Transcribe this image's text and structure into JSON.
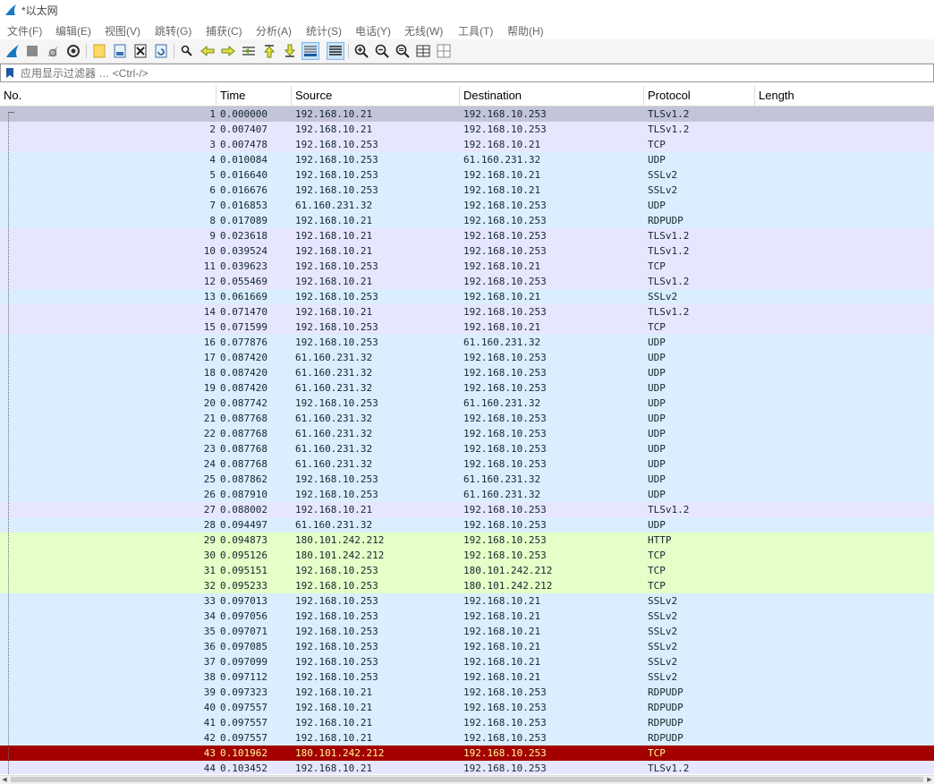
{
  "window": {
    "title": "*以太网"
  },
  "menu": [
    {
      "label": "文件(F)"
    },
    {
      "label": "编辑(E)"
    },
    {
      "label": "视图(V)"
    },
    {
      "label": "跳转(G)"
    },
    {
      "label": "捕获(C)"
    },
    {
      "label": "分析(A)"
    },
    {
      "label": "统计(S)"
    },
    {
      "label": "电话(Y)"
    },
    {
      "label": "无线(W)"
    },
    {
      "label": "工具(T)"
    },
    {
      "label": "帮助(H)"
    }
  ],
  "toolbar": [
    {
      "name": "start-capture-icon"
    },
    {
      "name": "stop-capture-icon"
    },
    {
      "name": "restart-capture-icon"
    },
    {
      "name": "capture-options-icon"
    },
    {
      "name": "open-file-icon"
    },
    {
      "name": "save-file-icon"
    },
    {
      "name": "close-file-icon"
    },
    {
      "name": "reload-file-icon"
    },
    {
      "name": "find-packet-icon"
    },
    {
      "name": "go-back-icon"
    },
    {
      "name": "go-forward-icon"
    },
    {
      "name": "go-to-packet-icon"
    },
    {
      "name": "go-first-packet-icon"
    },
    {
      "name": "go-last-packet-icon"
    },
    {
      "name": "auto-scroll-icon",
      "active": true
    },
    {
      "name": "colorize-icon",
      "active": true
    },
    {
      "name": "zoom-in-icon"
    },
    {
      "name": "zoom-out-icon"
    },
    {
      "name": "normal-size-icon"
    },
    {
      "name": "resize-columns-icon"
    }
  ],
  "filter": {
    "placeholder": "应用显示过滤器 … <Ctrl-/>",
    "value": ""
  },
  "columns": [
    "No.",
    "Time",
    "Source",
    "Destination",
    "Protocol",
    "Length"
  ],
  "colors": {
    "tls": "#e7e6ff",
    "tcp": "#e7e6ff",
    "udp": "#daeeff",
    "ssl": "#daeeff",
    "rdpudp": "#daeeff",
    "http": "#e4ffc7",
    "selected": "#c4c4d9",
    "error_bg": "#a40000",
    "error_fg": "#fffc9c"
  },
  "packets": [
    {
      "no": "1",
      "time": "0.000000",
      "src": "192.168.10.21",
      "dst": "192.168.10.253",
      "proto": "TLSv1.2",
      "cls": "selected"
    },
    {
      "no": "2",
      "time": "0.007407",
      "src": "192.168.10.21",
      "dst": "192.168.10.253",
      "proto": "TLSv1.2",
      "cls": "tls"
    },
    {
      "no": "3",
      "time": "0.007478",
      "src": "192.168.10.253",
      "dst": "192.168.10.21",
      "proto": "TCP",
      "cls": "tcp"
    },
    {
      "no": "4",
      "time": "0.010084",
      "src": "192.168.10.253",
      "dst": "61.160.231.32",
      "proto": "UDP",
      "cls": "udp"
    },
    {
      "no": "5",
      "time": "0.016640",
      "src": "192.168.10.253",
      "dst": "192.168.10.21",
      "proto": "SSLv2",
      "cls": "ssl"
    },
    {
      "no": "6",
      "time": "0.016676",
      "src": "192.168.10.253",
      "dst": "192.168.10.21",
      "proto": "SSLv2",
      "cls": "ssl"
    },
    {
      "no": "7",
      "time": "0.016853",
      "src": "61.160.231.32",
      "dst": "192.168.10.253",
      "proto": "UDP",
      "cls": "udp"
    },
    {
      "no": "8",
      "time": "0.017089",
      "src": "192.168.10.21",
      "dst": "192.168.10.253",
      "proto": "RDPUDP",
      "cls": "rdpudp"
    },
    {
      "no": "9",
      "time": "0.023618",
      "src": "192.168.10.21",
      "dst": "192.168.10.253",
      "proto": "TLSv1.2",
      "cls": "tls"
    },
    {
      "no": "10",
      "time": "0.039524",
      "src": "192.168.10.21",
      "dst": "192.168.10.253",
      "proto": "TLSv1.2",
      "cls": "tls"
    },
    {
      "no": "11",
      "time": "0.039623",
      "src": "192.168.10.253",
      "dst": "192.168.10.21",
      "proto": "TCP",
      "cls": "tcp"
    },
    {
      "no": "12",
      "time": "0.055469",
      "src": "192.168.10.21",
      "dst": "192.168.10.253",
      "proto": "TLSv1.2",
      "cls": "tls"
    },
    {
      "no": "13",
      "time": "0.061669",
      "src": "192.168.10.253",
      "dst": "192.168.10.21",
      "proto": "SSLv2",
      "cls": "ssl"
    },
    {
      "no": "14",
      "time": "0.071470",
      "src": "192.168.10.21",
      "dst": "192.168.10.253",
      "proto": "TLSv1.2",
      "cls": "tls"
    },
    {
      "no": "15",
      "time": "0.071599",
      "src": "192.168.10.253",
      "dst": "192.168.10.21",
      "proto": "TCP",
      "cls": "tcp"
    },
    {
      "no": "16",
      "time": "0.077876",
      "src": "192.168.10.253",
      "dst": "61.160.231.32",
      "proto": "UDP",
      "cls": "udp"
    },
    {
      "no": "17",
      "time": "0.087420",
      "src": "61.160.231.32",
      "dst": "192.168.10.253",
      "proto": "UDP",
      "cls": "udp"
    },
    {
      "no": "18",
      "time": "0.087420",
      "src": "61.160.231.32",
      "dst": "192.168.10.253",
      "proto": "UDP",
      "cls": "udp"
    },
    {
      "no": "19",
      "time": "0.087420",
      "src": "61.160.231.32",
      "dst": "192.168.10.253",
      "proto": "UDP",
      "cls": "udp"
    },
    {
      "no": "20",
      "time": "0.087742",
      "src": "192.168.10.253",
      "dst": "61.160.231.32",
      "proto": "UDP",
      "cls": "udp"
    },
    {
      "no": "21",
      "time": "0.087768",
      "src": "61.160.231.32",
      "dst": "192.168.10.253",
      "proto": "UDP",
      "cls": "udp"
    },
    {
      "no": "22",
      "time": "0.087768",
      "src": "61.160.231.32",
      "dst": "192.168.10.253",
      "proto": "UDP",
      "cls": "udp"
    },
    {
      "no": "23",
      "time": "0.087768",
      "src": "61.160.231.32",
      "dst": "192.168.10.253",
      "proto": "UDP",
      "cls": "udp"
    },
    {
      "no": "24",
      "time": "0.087768",
      "src": "61.160.231.32",
      "dst": "192.168.10.253",
      "proto": "UDP",
      "cls": "udp"
    },
    {
      "no": "25",
      "time": "0.087862",
      "src": "192.168.10.253",
      "dst": "61.160.231.32",
      "proto": "UDP",
      "cls": "udp"
    },
    {
      "no": "26",
      "time": "0.087910",
      "src": "192.168.10.253",
      "dst": "61.160.231.32",
      "proto": "UDP",
      "cls": "udp"
    },
    {
      "no": "27",
      "time": "0.088002",
      "src": "192.168.10.21",
      "dst": "192.168.10.253",
      "proto": "TLSv1.2",
      "cls": "tls"
    },
    {
      "no": "28",
      "time": "0.094497",
      "src": "61.160.231.32",
      "dst": "192.168.10.253",
      "proto": "UDP",
      "cls": "udp"
    },
    {
      "no": "29",
      "time": "0.094873",
      "src": "180.101.242.212",
      "dst": "192.168.10.253",
      "proto": "HTTP",
      "cls": "http"
    },
    {
      "no": "30",
      "time": "0.095126",
      "src": "180.101.242.212",
      "dst": "192.168.10.253",
      "proto": "TCP",
      "cls": "http"
    },
    {
      "no": "31",
      "time": "0.095151",
      "src": "192.168.10.253",
      "dst": "180.101.242.212",
      "proto": "TCP",
      "cls": "http"
    },
    {
      "no": "32",
      "time": "0.095233",
      "src": "192.168.10.253",
      "dst": "180.101.242.212",
      "proto": "TCP",
      "cls": "http"
    },
    {
      "no": "33",
      "time": "0.097013",
      "src": "192.168.10.253",
      "dst": "192.168.10.21",
      "proto": "SSLv2",
      "cls": "ssl"
    },
    {
      "no": "34",
      "time": "0.097056",
      "src": "192.168.10.253",
      "dst": "192.168.10.21",
      "proto": "SSLv2",
      "cls": "ssl"
    },
    {
      "no": "35",
      "time": "0.097071",
      "src": "192.168.10.253",
      "dst": "192.168.10.21",
      "proto": "SSLv2",
      "cls": "ssl"
    },
    {
      "no": "36",
      "time": "0.097085",
      "src": "192.168.10.253",
      "dst": "192.168.10.21",
      "proto": "SSLv2",
      "cls": "ssl"
    },
    {
      "no": "37",
      "time": "0.097099",
      "src": "192.168.10.253",
      "dst": "192.168.10.21",
      "proto": "SSLv2",
      "cls": "ssl"
    },
    {
      "no": "38",
      "time": "0.097112",
      "src": "192.168.10.253",
      "dst": "192.168.10.21",
      "proto": "SSLv2",
      "cls": "ssl"
    },
    {
      "no": "39",
      "time": "0.097323",
      "src": "192.168.10.21",
      "dst": "192.168.10.253",
      "proto": "RDPUDP",
      "cls": "rdpudp"
    },
    {
      "no": "40",
      "time": "0.097557",
      "src": "192.168.10.21",
      "dst": "192.168.10.253",
      "proto": "RDPUDP",
      "cls": "rdpudp"
    },
    {
      "no": "41",
      "time": "0.097557",
      "src": "192.168.10.21",
      "dst": "192.168.10.253",
      "proto": "RDPUDP",
      "cls": "rdpudp"
    },
    {
      "no": "42",
      "time": "0.097557",
      "src": "192.168.10.21",
      "dst": "192.168.10.253",
      "proto": "RDPUDP",
      "cls": "rdpudp"
    },
    {
      "no": "43",
      "time": "0.101962",
      "src": "180.101.242.212",
      "dst": "192.168.10.253",
      "proto": "TCP",
      "cls": "error"
    },
    {
      "no": "44",
      "time": "0.103452",
      "src": "192.168.10.21",
      "dst": "192.168.10.253",
      "proto": "TLSv1.2",
      "cls": "tls"
    }
  ]
}
